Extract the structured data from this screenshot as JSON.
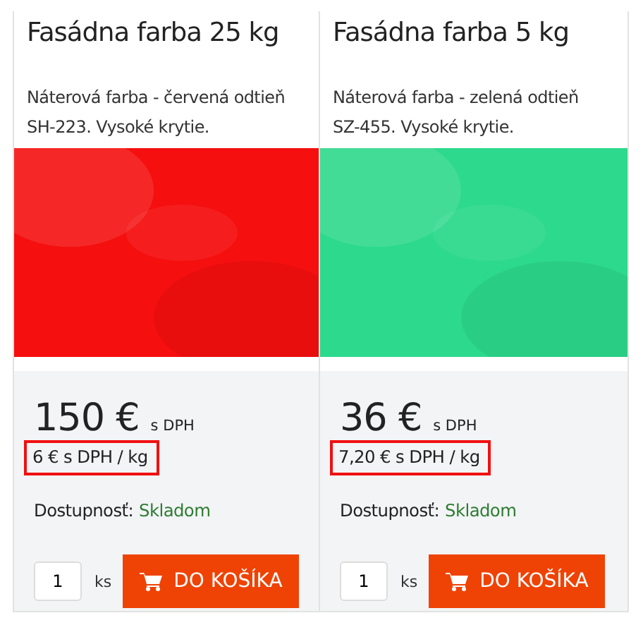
{
  "products": [
    {
      "title": "Fasádna farba 25 kg",
      "description": "Náterová farba - červená odtieň SH-223. Vysoké krytie.",
      "price": "150 €",
      "price_note": "s DPH",
      "unit_price": "6 € s DPH / kg",
      "unit_price_highlighted": true,
      "availability_label": "Dostupnosť:",
      "availability": "Skladom",
      "quantity": "1",
      "unit": "ks",
      "button": "DO KOŠÍKA"
    },
    {
      "title": "Fasádna farba 5 kg",
      "description": "Náterová farba - zelená odtieň SZ-455. Vysoké krytie.",
      "price": "36 €",
      "price_note": "s DPH",
      "unit_price": "7,20 € s DPH / kg",
      "unit_price_highlighted": true,
      "availability_label": "Dostupnosť:",
      "availability": "Skladom",
      "quantity": "1",
      "unit": "ks",
      "button": "DO KOŠÍKA"
    }
  ]
}
